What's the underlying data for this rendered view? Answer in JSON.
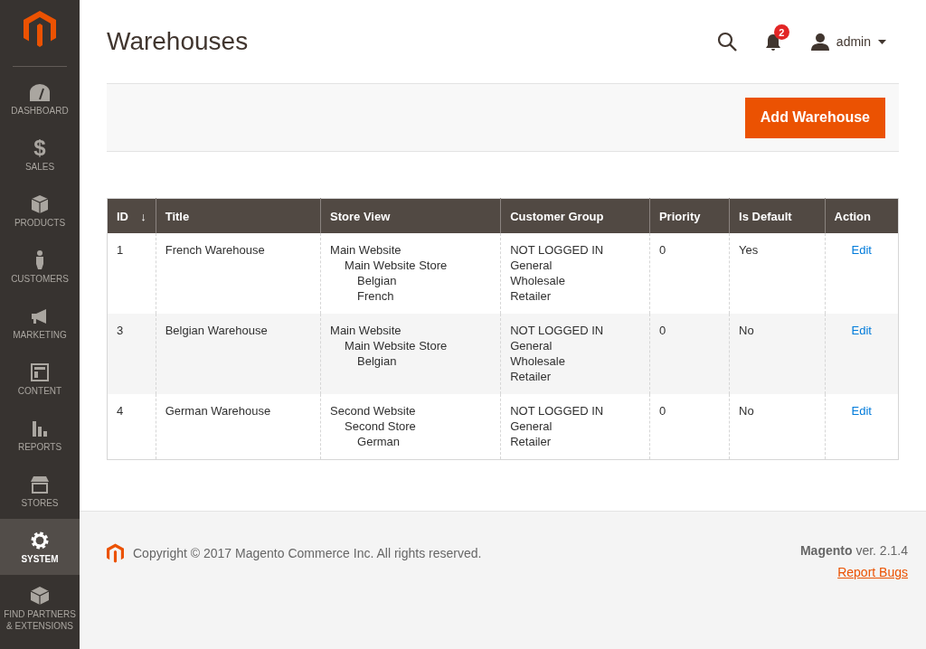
{
  "sidebar": {
    "items": [
      {
        "label": "DASHBOARD",
        "selected": false
      },
      {
        "label": "SALES",
        "selected": false,
        "glyph": "$"
      },
      {
        "label": "PRODUCTS",
        "selected": false
      },
      {
        "label": "CUSTOMERS",
        "selected": false
      },
      {
        "label": "MARKETING",
        "selected": false
      },
      {
        "label": "CONTENT",
        "selected": false
      },
      {
        "label": "REPORTS",
        "selected": false
      },
      {
        "label": "STORES",
        "selected": false
      },
      {
        "label": "SYSTEM",
        "selected": true
      },
      {
        "label": "FIND PARTNERS & EXTENSIONS",
        "selected": false
      }
    ]
  },
  "header": {
    "title": "Warehouses",
    "notifications": "2",
    "user": "admin"
  },
  "actions": {
    "add_button": "Add Warehouse"
  },
  "table": {
    "columns": [
      {
        "label": "ID",
        "sort_icon": "↓"
      },
      {
        "label": "Title"
      },
      {
        "label": "Store View"
      },
      {
        "label": "Customer Group"
      },
      {
        "label": "Priority"
      },
      {
        "label": "Is Default"
      },
      {
        "label": "Action"
      }
    ],
    "rows": [
      {
        "id": "1",
        "title": "French Warehouse",
        "store_view": [
          {
            "label": "Main Website",
            "children": [
              {
                "label": "Main Website Store",
                "children": [
                  {
                    "label": "Belgian"
                  },
                  {
                    "label": "French"
                  }
                ]
              }
            ]
          }
        ],
        "customer_groups": [
          "NOT LOGGED IN",
          "General",
          "Wholesale",
          "Retailer"
        ],
        "priority": "0",
        "is_default": "Yes",
        "action": "Edit"
      },
      {
        "id": "3",
        "title": "Belgian Warehouse",
        "store_view": [
          {
            "label": "Main Website",
            "children": [
              {
                "label": "Main Website Store",
                "children": [
                  {
                    "label": "Belgian"
                  }
                ]
              }
            ]
          }
        ],
        "customer_groups": [
          "NOT LOGGED IN",
          "General",
          "Wholesale",
          "Retailer"
        ],
        "priority": "0",
        "is_default": "No",
        "action": "Edit"
      },
      {
        "id": "4",
        "title": "German Warehouse",
        "store_view": [
          {
            "label": "Second Website",
            "children": [
              {
                "label": "Second Store",
                "children": [
                  {
                    "label": "German"
                  }
                ]
              }
            ]
          }
        ],
        "customer_groups": [
          "NOT LOGGED IN",
          "General",
          "Retailer"
        ],
        "priority": "0",
        "is_default": "No",
        "action": "Edit"
      }
    ]
  },
  "footer": {
    "copyright": "Copyright © 2017 Magento Commerce Inc. All rights reserved.",
    "version": "**Magento** ver. 2.1.4",
    "report_link": "Report Bugs"
  }
}
